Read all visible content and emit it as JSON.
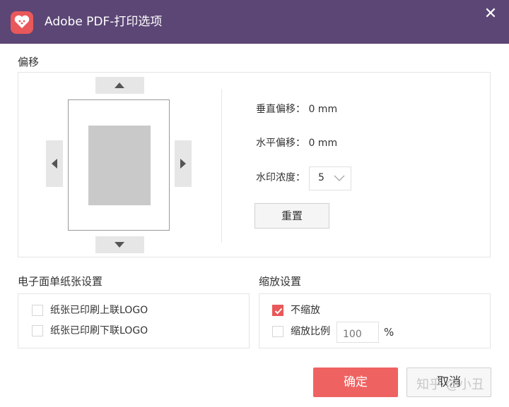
{
  "window": {
    "title": "Adobe PDF-打印选项",
    "close_glyph": "✕",
    "header_color": "#5b4675"
  },
  "offset": {
    "section_label": "偏移",
    "vertical_label": "垂直偏移：",
    "vertical_value": "0 mm",
    "horizontal_label": "水平偏移：",
    "horizontal_value": "0 mm",
    "watermark_label": "水印浓度：",
    "watermark_value": "5",
    "reset_label": "重置"
  },
  "paper_settings": {
    "section_label": "电子面单纸张设置",
    "option_upper": "纸张已印刷上联LOGO",
    "option_lower": "纸张已印刷下联LOGO",
    "upper_checked": false,
    "lower_checked": false
  },
  "scale_settings": {
    "section_label": "缩放设置",
    "no_scale_label": "不缩放",
    "no_scale_checked": true,
    "scale_ratio_label": "缩放比例",
    "scale_ratio_checked": false,
    "scale_placeholder": "100",
    "percent_symbol": "%"
  },
  "footer": {
    "ok_label": "确定",
    "cancel_label": "取消",
    "watermark_text": "知乎 @小丑",
    "accent_color": "#ee6361"
  },
  "icons": [
    "app-logo-icon",
    "close-icon",
    "arrow-up-icon",
    "arrow-down-icon",
    "arrow-left-icon",
    "arrow-right-icon",
    "chevron-down-icon",
    "checkmark-icon"
  ]
}
